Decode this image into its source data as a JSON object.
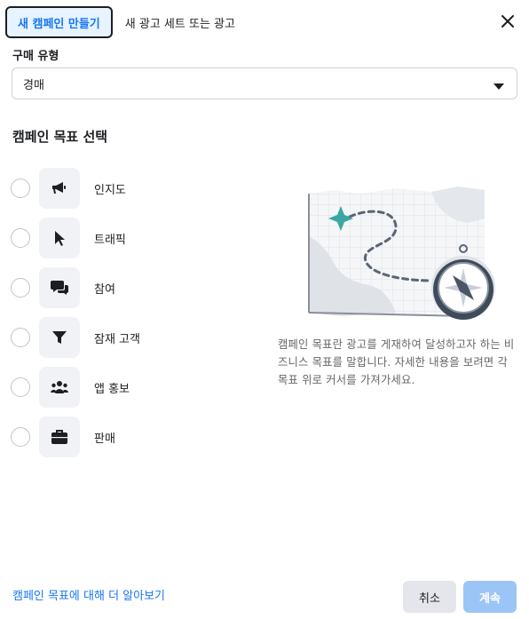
{
  "tabs": {
    "active": "새 캠페인 만들기",
    "other": "새 광고 세트 또는 광고"
  },
  "close_icon": "close-icon",
  "buying_type": {
    "label": "구매 유형",
    "value": "경매"
  },
  "objectives": {
    "title": "캠페인 목표 선택",
    "items": [
      {
        "label": "인지도",
        "icon": "megaphone-icon"
      },
      {
        "label": "트래픽",
        "icon": "cursor-icon"
      },
      {
        "label": "참여",
        "icon": "chat-bubbles-icon"
      },
      {
        "label": "잠재 고객",
        "icon": "funnel-icon"
      },
      {
        "label": "앱 홍보",
        "icon": "people-icon"
      },
      {
        "label": "판매",
        "icon": "briefcase-icon"
      }
    ]
  },
  "description": "캠페인 목표란 광고를 게재하여 달성하고자 하는 비즈니스 목표를 말합니다. 자세한 내용을 보려면 각 목표 위로 커서를 가져가세요.",
  "footer": {
    "learn_more": "캠페인 목표에 대해 더 알아보기",
    "cancel": "취소",
    "next": "계속"
  },
  "colors": {
    "accent": "#1877f2",
    "next_disabled": "#9cc5f7",
    "map_star": "#3aa7a3"
  }
}
